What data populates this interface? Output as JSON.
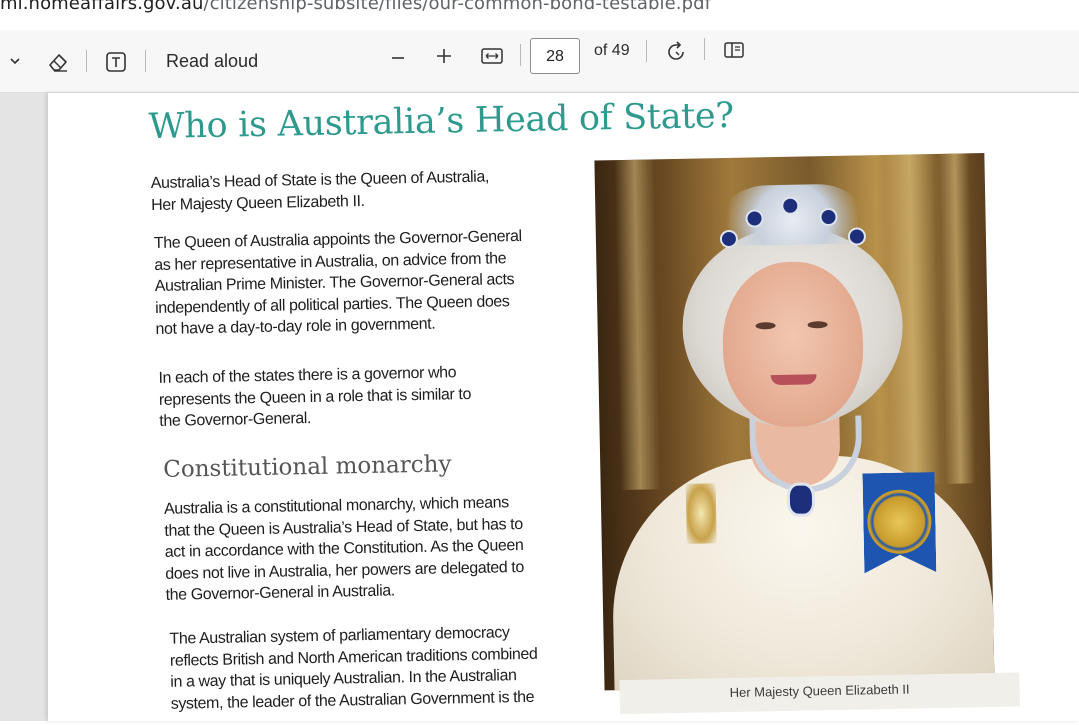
{
  "browser": {
    "url_host": "mi.homeaffairs.gov.au",
    "url_path": "/citizenship-subsite/files/our-common-bond-testable.pdf"
  },
  "toolbar": {
    "read_aloud_label": "Read aloud",
    "current_page": "28",
    "page_total_label": "of 49",
    "icons": {
      "chevron": "chevron-down-icon",
      "eraser": "eraser-icon",
      "text": "text-box-icon",
      "zoom_out": "minus-icon",
      "zoom_in": "plus-icon",
      "fit": "fit-width-icon",
      "rotate": "rotate-icon",
      "view": "page-view-icon"
    }
  },
  "document": {
    "title": "Who is Australia’s Head of State?",
    "para1": [
      "Australia’s Head of State is the Queen of Australia,",
      "Her Majesty Queen Elizabeth II."
    ],
    "para2": [
      "The Queen of Australia appoints the Governor-General",
      "as her representative in Australia, on advice from the",
      "Australian Prime Minister. The Governor-General acts",
      "independently of all political parties. The Queen does",
      "not have a day-to-day role in government."
    ],
    "para3": [
      "In each of the states there is a governor who",
      "represents the Queen in a role that is similar to",
      "the Governor-General."
    ],
    "subheading": "Constitutional monarchy",
    "para4": [
      "Australia is a constitutional monarchy, which means",
      "that the Queen is Australia’s Head of State, but has to",
      "act in accordance with the Constitution. As the Queen",
      "does not live in Australia, her powers are delegated to",
      "the Governor-General in Australia."
    ],
    "para5": [
      "The Australian system of parliamentary democracy",
      "reflects British and North American traditions combined",
      "in a way that is uniquely Australian. In the Australian",
      "system, the leader of the Australian Government is the"
    ],
    "photo_caption": "Her Majesty Queen Elizabeth II"
  },
  "colors": {
    "title_teal": "#2e9a8e",
    "toolbar_bg": "#f7f7f7",
    "viewer_bg": "#e4e4e4"
  }
}
